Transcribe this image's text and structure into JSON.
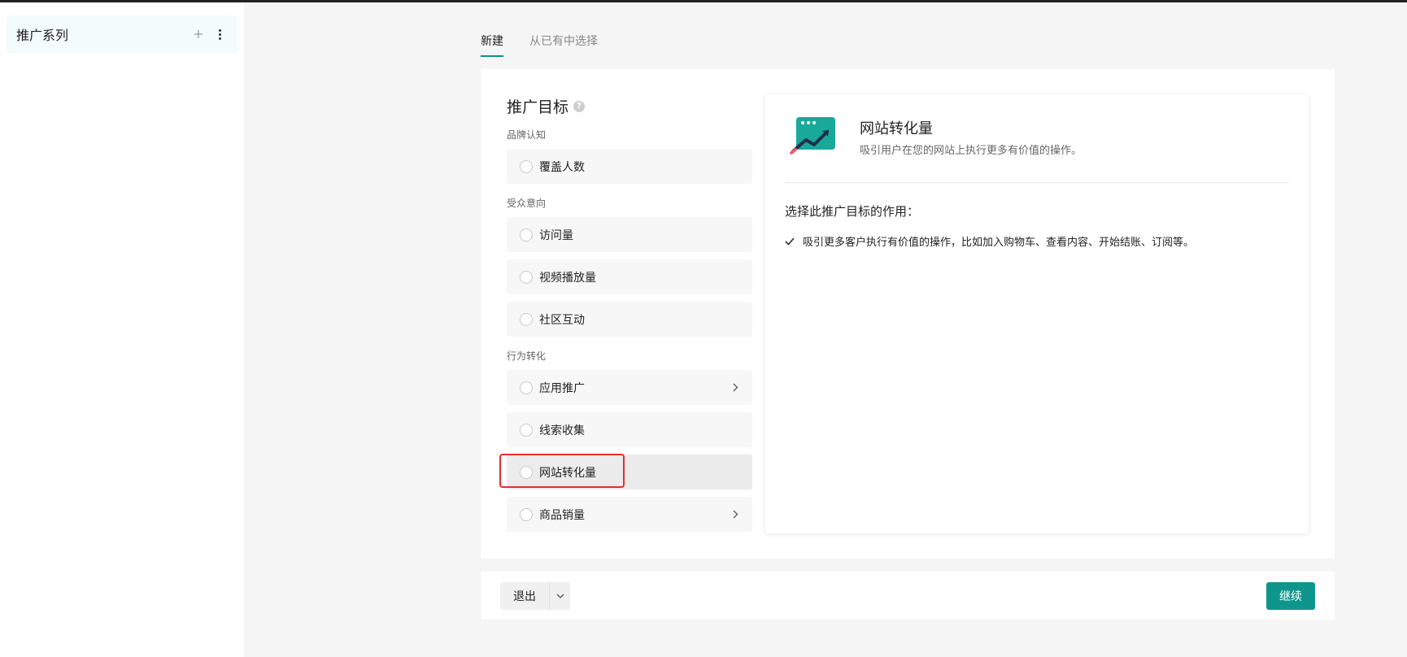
{
  "sidebar": {
    "title": "推广系列",
    "add_icon": "plus-icon",
    "more_icon": "more-vertical-icon"
  },
  "tabs": [
    {
      "label": "新建",
      "active": true
    },
    {
      "label": "从已有中选择",
      "active": false
    }
  ],
  "objective": {
    "title": "推广目标",
    "help_icon": "?",
    "groups": [
      {
        "label": "品牌认知",
        "options": [
          {
            "label": "覆盖人数"
          }
        ]
      },
      {
        "label": "受众意向",
        "options": [
          {
            "label": "访问量"
          },
          {
            "label": "视频播放量"
          },
          {
            "label": "社区互动"
          }
        ]
      },
      {
        "label": "行为转化",
        "options": [
          {
            "label": "应用推广",
            "chevron": true
          },
          {
            "label": "线索收集"
          },
          {
            "label": "网站转化量",
            "highlighted": true
          },
          {
            "label": "商品销量",
            "chevron": true
          }
        ]
      }
    ]
  },
  "detail": {
    "icon": "website-conversion-icon",
    "title": "网站转化量",
    "description": "吸引用户在您的网站上执行更多有价值的操作。",
    "subtitle": "选择此推广目标的作用：",
    "point": "吸引更多客户执行有价值的操作，比如加入购物车、查看内容、开始结账、订阅等。"
  },
  "footer": {
    "exit_label": "退出",
    "continue_label": "继续"
  },
  "colors": {
    "accent": "#0f968c",
    "highlight": "#e0312b"
  }
}
